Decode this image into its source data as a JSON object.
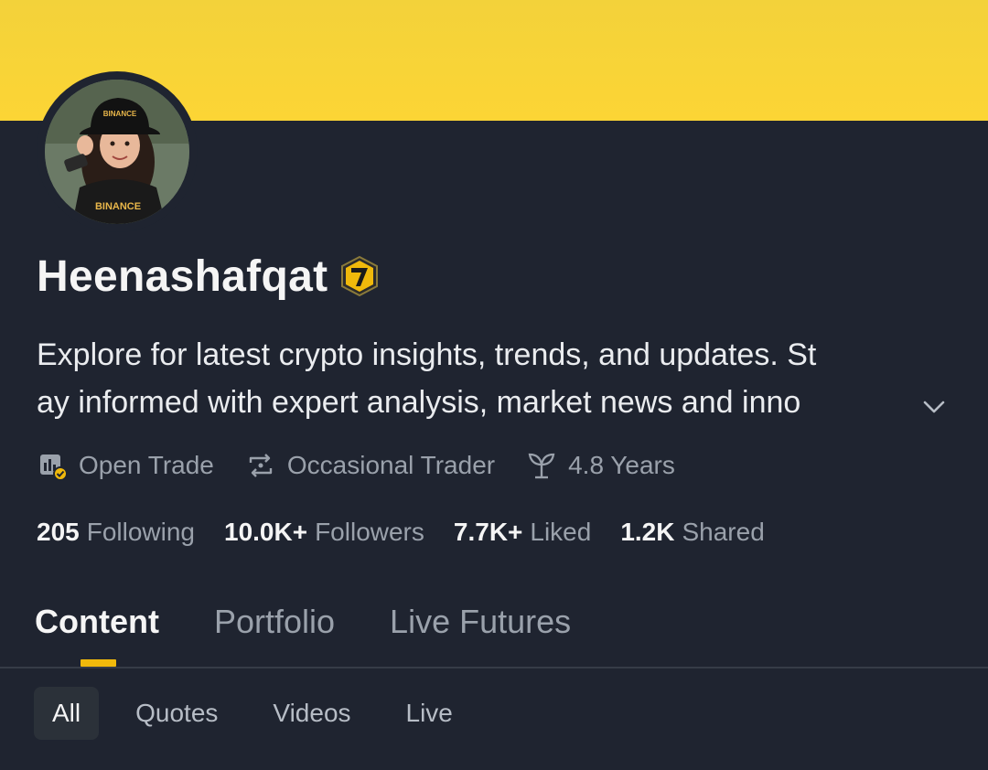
{
  "colors": {
    "banner_top": "#f3d23a",
    "banner_bottom": "#fcd535",
    "background": "#1f2430",
    "accent": "#f0b90b",
    "muted_text": "#9aa1ab"
  },
  "profile": {
    "avatar_icon": "profile-photo",
    "avatar_text": "BINANCE",
    "name": "Heenashafqat",
    "badge_icon": "binance-7-badge",
    "bio_line_1": "Explore for latest crypto insights, trends, and updates. St",
    "bio_line_2": "ay informed with expert analysis, market news and inno",
    "expand_icon": "chevron-down-icon"
  },
  "meta": [
    {
      "icon": "open-trade-icon",
      "label": "Open Trade"
    },
    {
      "icon": "swap-icon",
      "label": "Occasional Trader"
    },
    {
      "icon": "sprout-icon",
      "label": "4.8 Years"
    }
  ],
  "stats": [
    {
      "value": "205",
      "label": "Following"
    },
    {
      "value": "10.0K+",
      "label": "Followers"
    },
    {
      "value": "7.7K+",
      "label": "Liked"
    },
    {
      "value": "1.2K",
      "label": "Shared"
    }
  ],
  "tabs": [
    {
      "label": "Content",
      "active": true
    },
    {
      "label": "Portfolio",
      "active": false
    },
    {
      "label": "Live Futures",
      "active": false
    }
  ],
  "filters": [
    {
      "label": "All",
      "active": true
    },
    {
      "label": "Quotes",
      "active": false
    },
    {
      "label": "Videos",
      "active": false
    },
    {
      "label": "Live",
      "active": false
    }
  ]
}
